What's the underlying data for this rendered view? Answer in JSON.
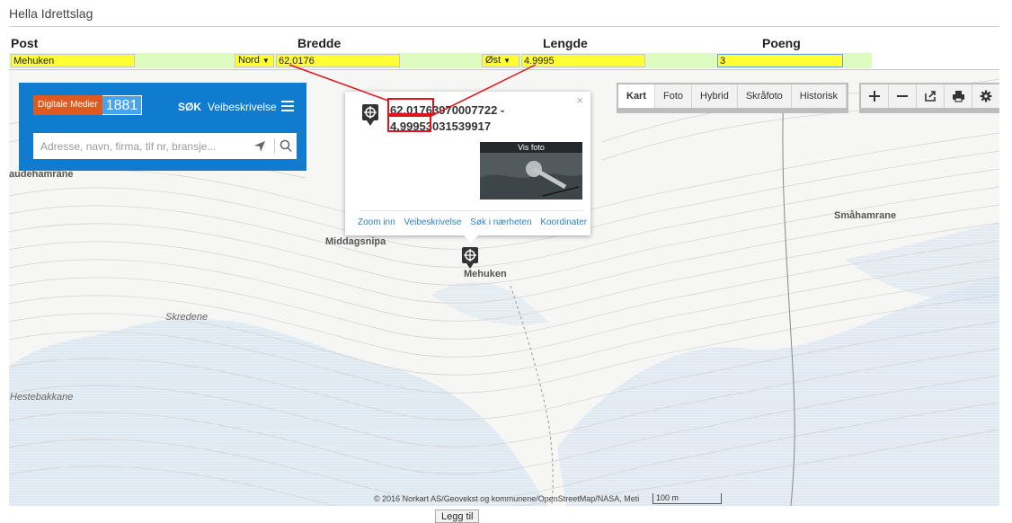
{
  "app": {
    "title": "Hella Idrettslag"
  },
  "columns": {
    "post": "Post",
    "bredde": "Bredde",
    "lengde": "Lengde",
    "poeng": "Poeng"
  },
  "form": {
    "post_value": "Mehuken",
    "lat_dir": "Nord",
    "lat_value": "62.0176",
    "lon_dir": "Øst",
    "lon_value": "4.9995",
    "poeng_value": "3"
  },
  "map": {
    "search_panel": {
      "logo_left": "Digitale Medier",
      "logo_right": "1881",
      "search_tab": "SØK",
      "route_tab": "Veibeskrivelse",
      "search_placeholder": "Adresse, navn, firma, tlf nr, bransje..."
    },
    "popup": {
      "coord_line1": "62.0176 3970007722 -",
      "coord_line2": "4.9995 3031539917",
      "coord_line1_a": "62.0176",
      "coord_line1_b": "3970007722 -",
      "coord_line2_a": "4.9995",
      "coord_line2_b": "3031539917",
      "photo_label": "Vis foto",
      "close": "×",
      "links": [
        "Zoom inn",
        "Veibeskrivelse",
        "Søk i nærheten",
        "Koordinater"
      ]
    },
    "layers": [
      "Kart",
      "Foto",
      "Hybrid",
      "Skråfoto",
      "Historisk"
    ],
    "active_layer": "Kart",
    "tools": [
      "zoom-in",
      "zoom-out",
      "share",
      "print",
      "settings"
    ],
    "places": {
      "audehamrane": "audehamrane",
      "middagsnipa": "Middagsnipa",
      "mehuken": "Mehuken",
      "smaahamrane": "Småhamrane",
      "skredene": "Skredene",
      "hestebakkane": "Hestebakkane"
    },
    "attribution": "© 2016 Norkart AS/Geovekst og kommunene/OpenStreetMap/NASA, Meti",
    "scale": "100 m"
  },
  "actions": {
    "add": "Legg til"
  },
  "colors": {
    "field_yellow": "#ffff33",
    "row_green": "#dffcc0",
    "panel_blue": "#0f7ccf",
    "highlight_red": "#e0151b"
  }
}
